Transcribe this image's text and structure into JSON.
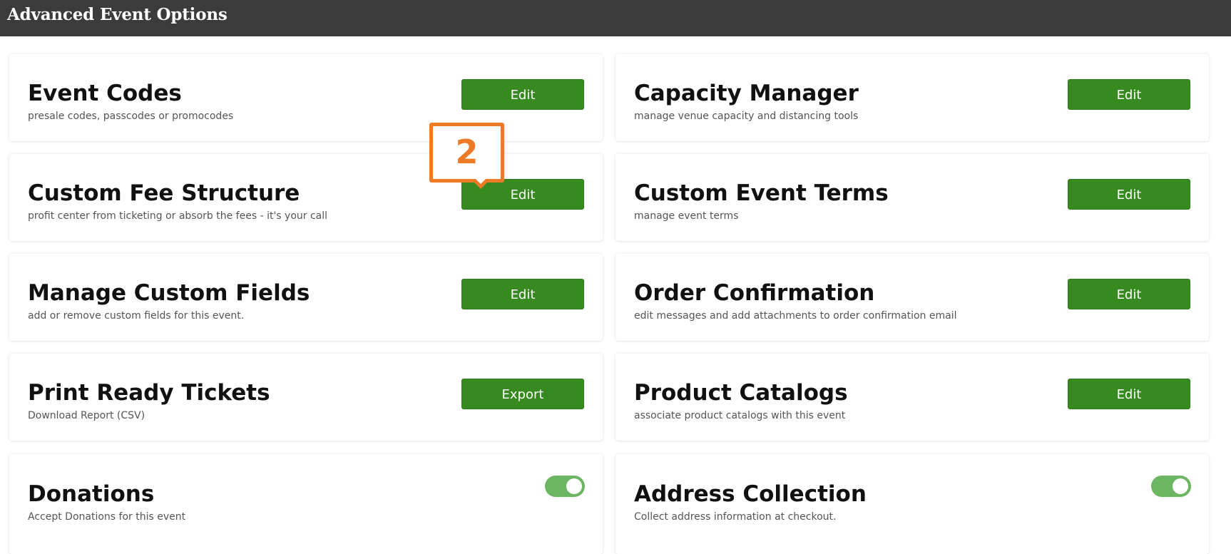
{
  "header": {
    "title": "Advanced Event Options"
  },
  "cards": [
    {
      "title": "Event Codes",
      "desc": "presale codes, passcodes or promocodes",
      "action": "Edit"
    },
    {
      "title": "Capacity Manager",
      "desc": "manage venue capacity and distancing tools",
      "action": "Edit"
    },
    {
      "title": "Custom Fee Structure",
      "desc": "profit center from ticketing or absorb the fees - it's your call",
      "action": "Edit"
    },
    {
      "title": "Custom Event Terms",
      "desc": "manage event terms",
      "action": "Edit"
    },
    {
      "title": "Manage Custom Fields",
      "desc": "add or remove custom fields for this event.",
      "action": "Edit"
    },
    {
      "title": "Order Confirmation",
      "desc": "edit messages and add attachments to order confirmation email",
      "action": "Edit"
    },
    {
      "title": "Print Ready Tickets",
      "desc": "Download Report (CSV)",
      "action": "Export"
    },
    {
      "title": "Product Catalogs",
      "desc": "associate product catalogs with this event",
      "action": "Edit"
    },
    {
      "title": "Donations",
      "desc": "Accept Donations for this event",
      "toggle_on": true
    },
    {
      "title": "Address Collection",
      "desc": "Collect address information at checkout.",
      "toggle_on": true
    }
  ],
  "callout": {
    "label": "2"
  },
  "colors": {
    "header_bg": "#3b3b3b",
    "button_green": "#368a1f",
    "toggle_green": "#6cb562",
    "callout_orange": "#ec7a26"
  }
}
